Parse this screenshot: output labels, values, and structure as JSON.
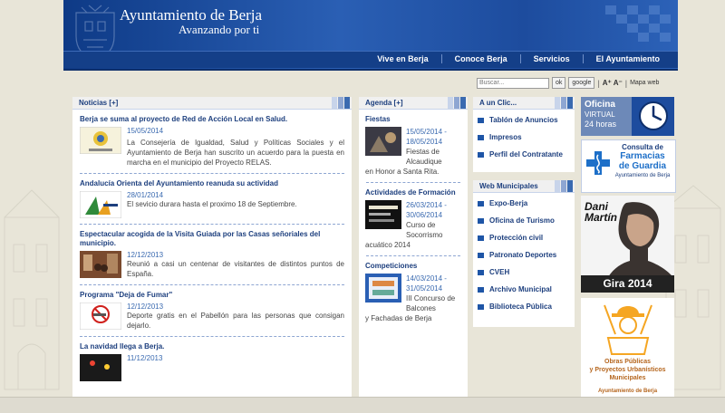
{
  "header": {
    "title": "Ayuntamiento de Berja",
    "subtitle": "Avanzando por ti"
  },
  "nav": [
    "Vive en Berja",
    "Conoce Berja",
    "Servicios",
    "El Ayuntamiento"
  ],
  "search": {
    "placeholder": "Buscar...",
    "ok": "ok",
    "google": "google",
    "font_size": "A⁺ A⁻",
    "sep": "|",
    "map": "Mapa web"
  },
  "news": {
    "title": "Noticias [+]",
    "items": [
      {
        "title": "Berja se suma al proyecto de Red de Acción Local en Salud.",
        "date": "15/05/2014",
        "text": "La Consejería de Igualdad, Salud y Políticas Sociales y el Ayuntamiento de Berja han suscrito un acuerdo para la puesta en marcha en el municipio del Proyecto RELAS."
      },
      {
        "title": "Andalucía Orienta del Ayuntamiento reanuda su actividad",
        "date": "28/01/2014",
        "text": "El sevicio durara hasta el proximo 18 de Septiembre."
      },
      {
        "title": "Espectacular acogida de la Visita Guiada por las Casas señoriales del municipio.",
        "date": "12/12/2013",
        "text": "Reunió a casi un centenar de visitantes de distintos puntos de España."
      },
      {
        "title": "Programa \"Deja de Fumar\"",
        "date": "12/12/2013",
        "text": "Deporte gratis en el Pabellón para las personas que consigan dejarlo."
      },
      {
        "title": "La navidad llega a Berja.",
        "date": "11/12/2013",
        "text": ""
      }
    ]
  },
  "agenda": {
    "title": "Agenda [+]",
    "items": [
      {
        "title": "Fiestas",
        "date1": "15/05/2014 -",
        "date2": "18/05/2014",
        "text1": "Fiestas de Alcaudique",
        "text2": "en Honor a Santa Rita."
      },
      {
        "title": "Actividades de Formación",
        "date1": "26/03/2014 -",
        "date2": "30/06/2014",
        "text1": "Curso de Socorrismo",
        "text2": "acuático 2014"
      },
      {
        "title": "Competiciones",
        "date1": "14/03/2014 -",
        "date2": "31/05/2014",
        "text1": "III Concurso de Balcones",
        "text2": "y Fachadas de Berja"
      }
    ]
  },
  "aunclic": {
    "title": "A un Clic...",
    "items": [
      "Tablón de Anuncios",
      "Impresos",
      "Perfil del Contratante"
    ]
  },
  "webmun": {
    "title": "Web Municipales",
    "items": [
      "Expo-Berja",
      "Oficina de Turismo",
      "Protección civil",
      "Patronato Deportes",
      "CVEH",
      "Archivo Municipal",
      "Biblioteca Pública"
    ]
  },
  "banners": {
    "oficina": {
      "l1": "Oficina",
      "l2": "VIRTUAL",
      "l3": "24 horas"
    },
    "farmacias": {
      "l1": "Consulta de",
      "l2": "Farmacias",
      "l3": "de Guardia",
      "l4": "Ayuntamiento de Berja"
    },
    "dani": {
      "l1": "Dani",
      "l2": "Martín",
      "l3": "Gira 2014"
    },
    "obras": {
      "l1": "Obras Públicas",
      "l2": "y Proyectos Urbanísticos",
      "l3": "Municipales",
      "l4": "Ayuntamiento de Berja"
    }
  },
  "colors": {
    "brand": "#143f88",
    "link": "#1d3f7e",
    "date": "#3a6ab0"
  }
}
